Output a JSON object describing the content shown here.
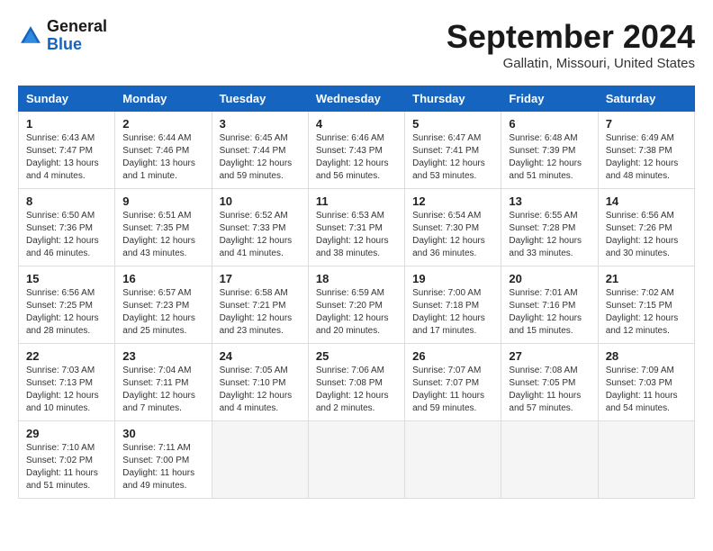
{
  "header": {
    "logo_general": "General",
    "logo_blue": "Blue",
    "month_title": "September 2024",
    "location": "Gallatin, Missouri, United States"
  },
  "weekdays": [
    "Sunday",
    "Monday",
    "Tuesday",
    "Wednesday",
    "Thursday",
    "Friday",
    "Saturday"
  ],
  "weeks": [
    [
      {
        "day": "1",
        "sunrise": "6:43 AM",
        "sunset": "7:47 PM",
        "daylight": "13 hours and 4 minutes."
      },
      {
        "day": "2",
        "sunrise": "6:44 AM",
        "sunset": "7:46 PM",
        "daylight": "13 hours and 1 minute."
      },
      {
        "day": "3",
        "sunrise": "6:45 AM",
        "sunset": "7:44 PM",
        "daylight": "12 hours and 59 minutes."
      },
      {
        "day": "4",
        "sunrise": "6:46 AM",
        "sunset": "7:43 PM",
        "daylight": "12 hours and 56 minutes."
      },
      {
        "day": "5",
        "sunrise": "6:47 AM",
        "sunset": "7:41 PM",
        "daylight": "12 hours and 53 minutes."
      },
      {
        "day": "6",
        "sunrise": "6:48 AM",
        "sunset": "7:39 PM",
        "daylight": "12 hours and 51 minutes."
      },
      {
        "day": "7",
        "sunrise": "6:49 AM",
        "sunset": "7:38 PM",
        "daylight": "12 hours and 48 minutes."
      }
    ],
    [
      {
        "day": "8",
        "sunrise": "6:50 AM",
        "sunset": "7:36 PM",
        "daylight": "12 hours and 46 minutes."
      },
      {
        "day": "9",
        "sunrise": "6:51 AM",
        "sunset": "7:35 PM",
        "daylight": "12 hours and 43 minutes."
      },
      {
        "day": "10",
        "sunrise": "6:52 AM",
        "sunset": "7:33 PM",
        "daylight": "12 hours and 41 minutes."
      },
      {
        "day": "11",
        "sunrise": "6:53 AM",
        "sunset": "7:31 PM",
        "daylight": "12 hours and 38 minutes."
      },
      {
        "day": "12",
        "sunrise": "6:54 AM",
        "sunset": "7:30 PM",
        "daylight": "12 hours and 36 minutes."
      },
      {
        "day": "13",
        "sunrise": "6:55 AM",
        "sunset": "7:28 PM",
        "daylight": "12 hours and 33 minutes."
      },
      {
        "day": "14",
        "sunrise": "6:56 AM",
        "sunset": "7:26 PM",
        "daylight": "12 hours and 30 minutes."
      }
    ],
    [
      {
        "day": "15",
        "sunrise": "6:56 AM",
        "sunset": "7:25 PM",
        "daylight": "12 hours and 28 minutes."
      },
      {
        "day": "16",
        "sunrise": "6:57 AM",
        "sunset": "7:23 PM",
        "daylight": "12 hours and 25 minutes."
      },
      {
        "day": "17",
        "sunrise": "6:58 AM",
        "sunset": "7:21 PM",
        "daylight": "12 hours and 23 minutes."
      },
      {
        "day": "18",
        "sunrise": "6:59 AM",
        "sunset": "7:20 PM",
        "daylight": "12 hours and 20 minutes."
      },
      {
        "day": "19",
        "sunrise": "7:00 AM",
        "sunset": "7:18 PM",
        "daylight": "12 hours and 17 minutes."
      },
      {
        "day": "20",
        "sunrise": "7:01 AM",
        "sunset": "7:16 PM",
        "daylight": "12 hours and 15 minutes."
      },
      {
        "day": "21",
        "sunrise": "7:02 AM",
        "sunset": "7:15 PM",
        "daylight": "12 hours and 12 minutes."
      }
    ],
    [
      {
        "day": "22",
        "sunrise": "7:03 AM",
        "sunset": "7:13 PM",
        "daylight": "12 hours and 10 minutes."
      },
      {
        "day": "23",
        "sunrise": "7:04 AM",
        "sunset": "7:11 PM",
        "daylight": "12 hours and 7 minutes."
      },
      {
        "day": "24",
        "sunrise": "7:05 AM",
        "sunset": "7:10 PM",
        "daylight": "12 hours and 4 minutes."
      },
      {
        "day": "25",
        "sunrise": "7:06 AM",
        "sunset": "7:08 PM",
        "daylight": "12 hours and 2 minutes."
      },
      {
        "day": "26",
        "sunrise": "7:07 AM",
        "sunset": "7:07 PM",
        "daylight": "11 hours and 59 minutes."
      },
      {
        "day": "27",
        "sunrise": "7:08 AM",
        "sunset": "7:05 PM",
        "daylight": "11 hours and 57 minutes."
      },
      {
        "day": "28",
        "sunrise": "7:09 AM",
        "sunset": "7:03 PM",
        "daylight": "11 hours and 54 minutes."
      }
    ],
    [
      {
        "day": "29",
        "sunrise": "7:10 AM",
        "sunset": "7:02 PM",
        "daylight": "11 hours and 51 minutes."
      },
      {
        "day": "30",
        "sunrise": "7:11 AM",
        "sunset": "7:00 PM",
        "daylight": "11 hours and 49 minutes."
      },
      null,
      null,
      null,
      null,
      null
    ]
  ]
}
